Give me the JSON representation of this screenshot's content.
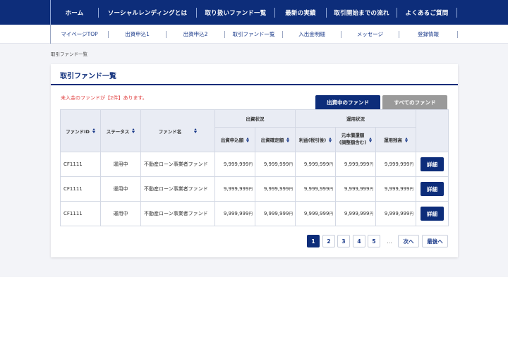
{
  "top_nav": [
    "ホーム",
    "ソーシャルレンディングとは",
    "取り扱いファンド一覧",
    "最新の実績",
    "取引開始までの流れ",
    "よくあるご質問"
  ],
  "sub_nav": [
    "マイページTOP",
    "出資申込1",
    "出資申込2",
    "取引ファンド一覧",
    "入出金明細",
    "メッセージ",
    "登録情報"
  ],
  "breadcrumb": "取引ファンド一覧",
  "card_title": "取引ファンド一覧",
  "notice": "未入金のファンドが【2件】あります。",
  "tabs": {
    "active": "出資中のファンド",
    "inactive": "すべてのファンド"
  },
  "table": {
    "headers": {
      "fund_id": "ファンドID",
      "status": "ステータス",
      "fund_name": "ファンド名",
      "investment_status": "出資状況",
      "operation_status": "運用状況",
      "applied_amount": "出資申込額",
      "confirmed_amount": "出資確定額",
      "profit": "利益(税引後)",
      "principal_line1": "元本償還額",
      "principal_line2": "(調整額含む)",
      "balance": "運用残高"
    },
    "yen_unit": "円",
    "detail_label": "詳細",
    "rows": [
      {
        "id": "CF1111",
        "status": "運用中",
        "name": "不動産ローン事業者ファンド",
        "applied": "9,999,999",
        "confirmed": "9,999,999",
        "profit": "9,999,999",
        "principal": "9,999,999",
        "balance": "9,999,999"
      },
      {
        "id": "CF1111",
        "status": "運用中",
        "name": "不動産ローン事業者ファンド",
        "applied": "9,999,999",
        "confirmed": "9,999,999",
        "profit": "9,999,999",
        "principal": "9,999,999",
        "balance": "9,999,999"
      },
      {
        "id": "CF1111",
        "status": "運用中",
        "name": "不動産ローン事業者ファンド",
        "applied": "9,999,999",
        "confirmed": "9,999,999",
        "profit": "9,999,999",
        "principal": "9,999,999",
        "balance": "9,999,999"
      }
    ]
  },
  "pagination": {
    "pages": [
      "1",
      "2",
      "3",
      "4",
      "5"
    ],
    "current": "1",
    "ellipsis": "…",
    "next": "次へ",
    "last": "最後へ"
  },
  "colors": {
    "primary": "#0d2d7a",
    "notice": "#e04040",
    "inactive_tab": "#9a9a9a",
    "band": "#f3f4f8"
  }
}
